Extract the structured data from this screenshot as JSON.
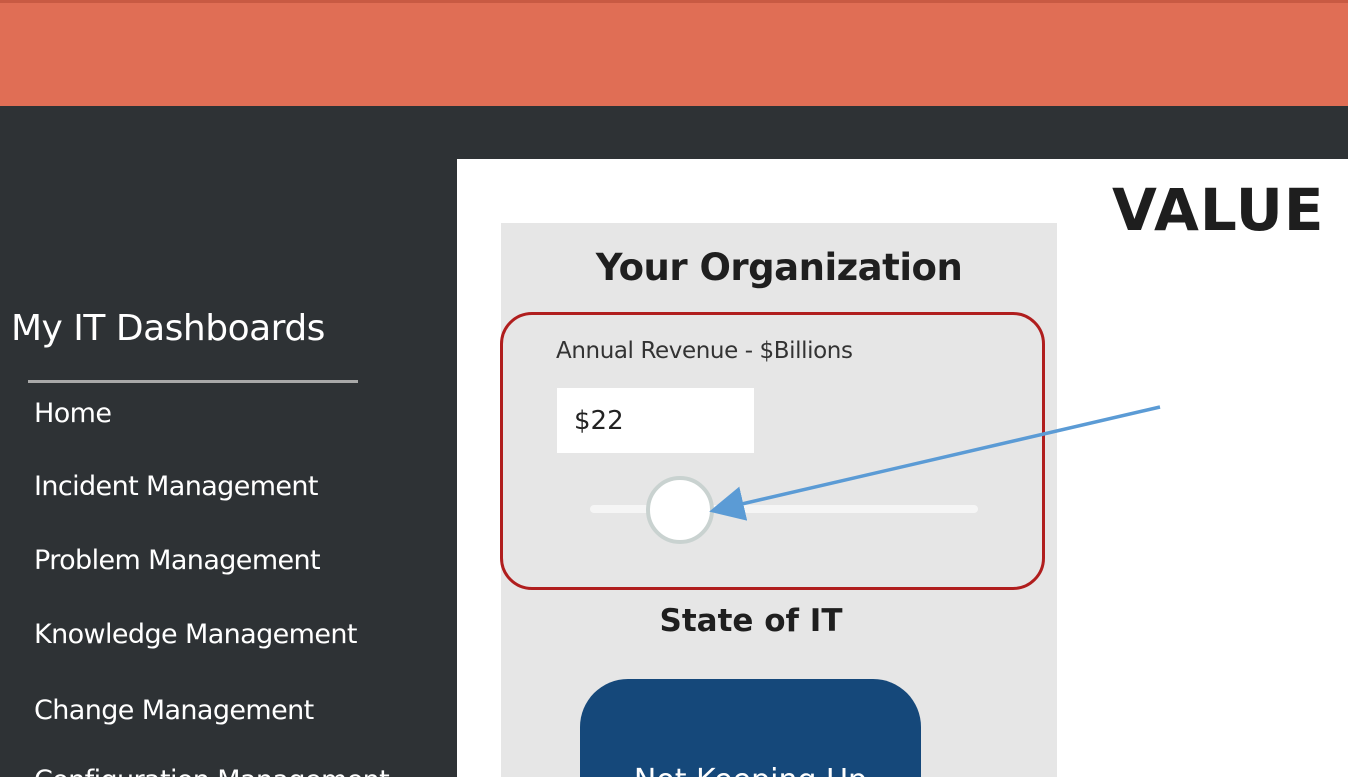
{
  "sidebar": {
    "title": "My IT Dashboards",
    "items": [
      {
        "label": "Home"
      },
      {
        "label": "Incident Management"
      },
      {
        "label": "Problem Management"
      },
      {
        "label": "Knowledge Management"
      },
      {
        "label": "Change Management"
      },
      {
        "label": "Configuration Management"
      }
    ]
  },
  "main": {
    "heading": "VALUE O",
    "organization": {
      "title": "Your Organization",
      "revenue_label": "Annual Revenue - $Billions",
      "revenue_value": "$22"
    },
    "state": {
      "title": "State of IT",
      "button_label": "Not Keeping Up"
    }
  },
  "colors": {
    "topbar": "#e06e55",
    "background": "#2e3235",
    "card": "#e6e6e6",
    "highlight": "#b01e1e",
    "arrow": "#5b9bd5",
    "state_button": "#15487a"
  }
}
